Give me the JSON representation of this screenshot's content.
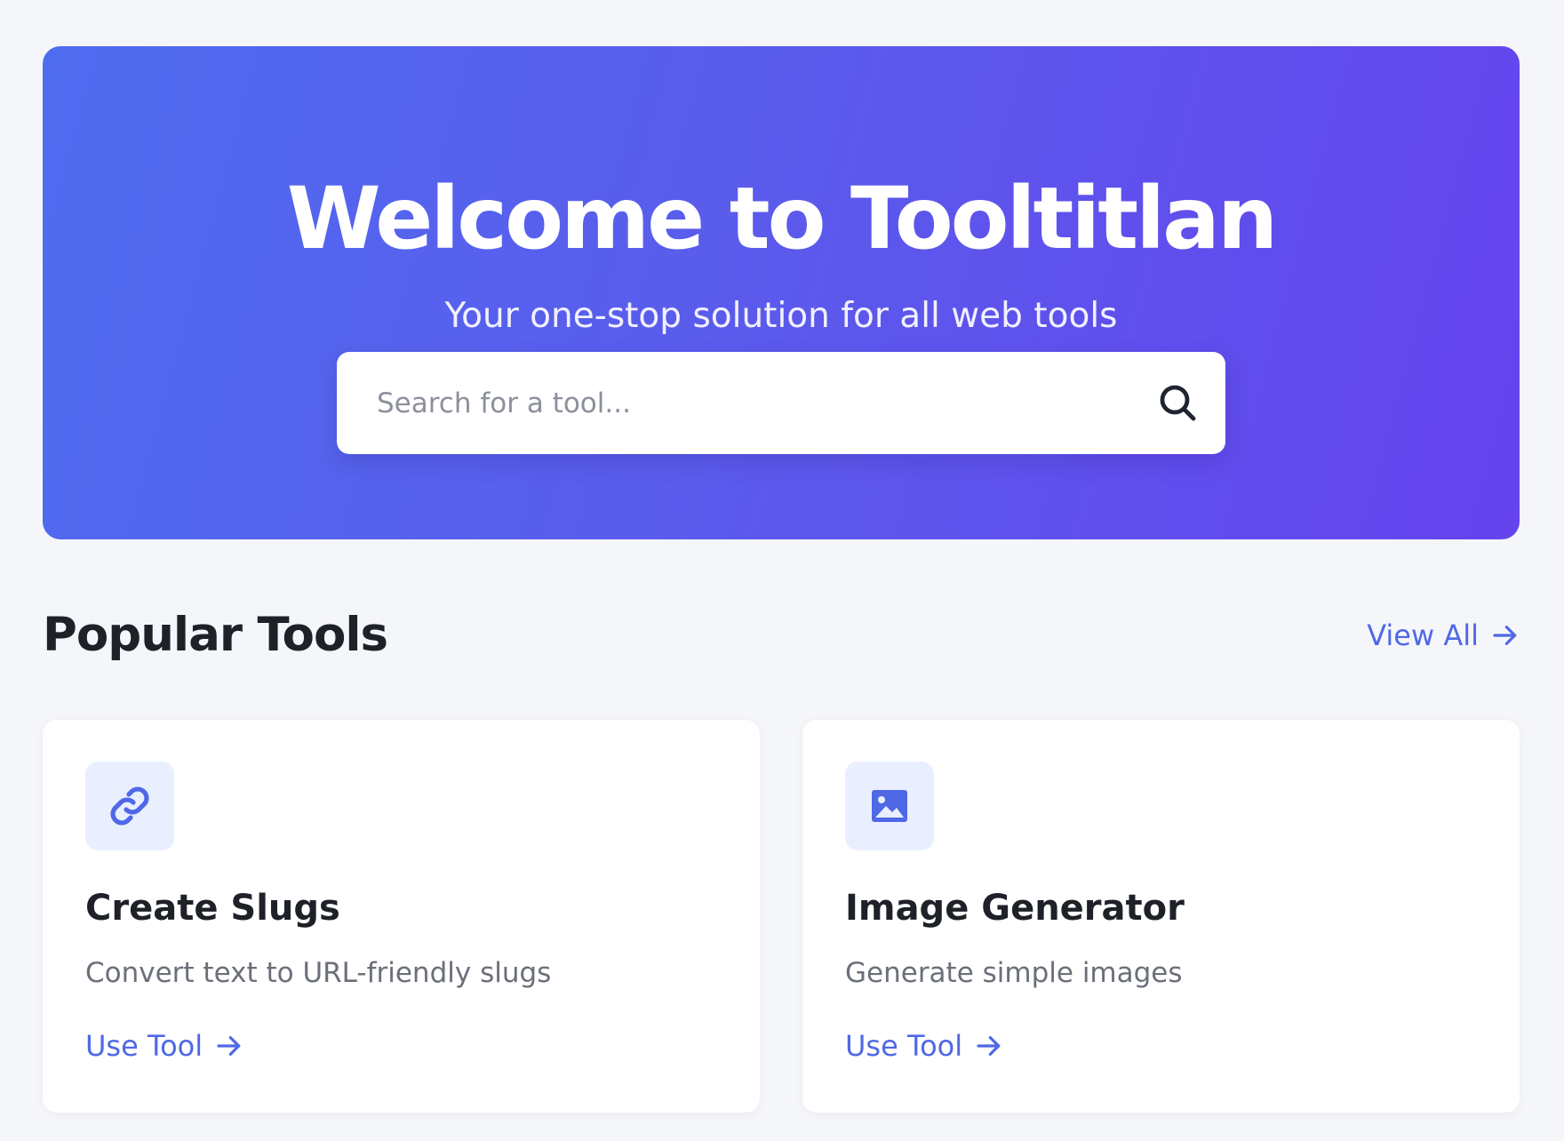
{
  "hero": {
    "title": "Welcome to Tooltitlan",
    "subtitle": "Your one-stop solution for all web tools",
    "search": {
      "placeholder": "Search for a tool...",
      "value": "",
      "icon": "search-icon"
    }
  },
  "popular": {
    "title": "Popular Tools",
    "view_all_label": "View All",
    "view_all_icon": "arrow-right-icon",
    "tools": [
      {
        "icon": "link-icon",
        "title": "Create Slugs",
        "description": "Convert text to URL-friendly slugs",
        "cta": "Use Tool"
      },
      {
        "icon": "image-icon",
        "title": "Image Generator",
        "description": "Generate simple images",
        "cta": "Use Tool"
      }
    ]
  },
  "colors": {
    "hero_gradient_start": "#4f6cef",
    "hero_gradient_end": "#6543ee",
    "accent": "#4f68e6",
    "icon_tile_bg": "#e9effe",
    "page_bg": "#f5f6fa",
    "heading_text": "#1e2128",
    "muted_text": "#6b6f7a"
  }
}
